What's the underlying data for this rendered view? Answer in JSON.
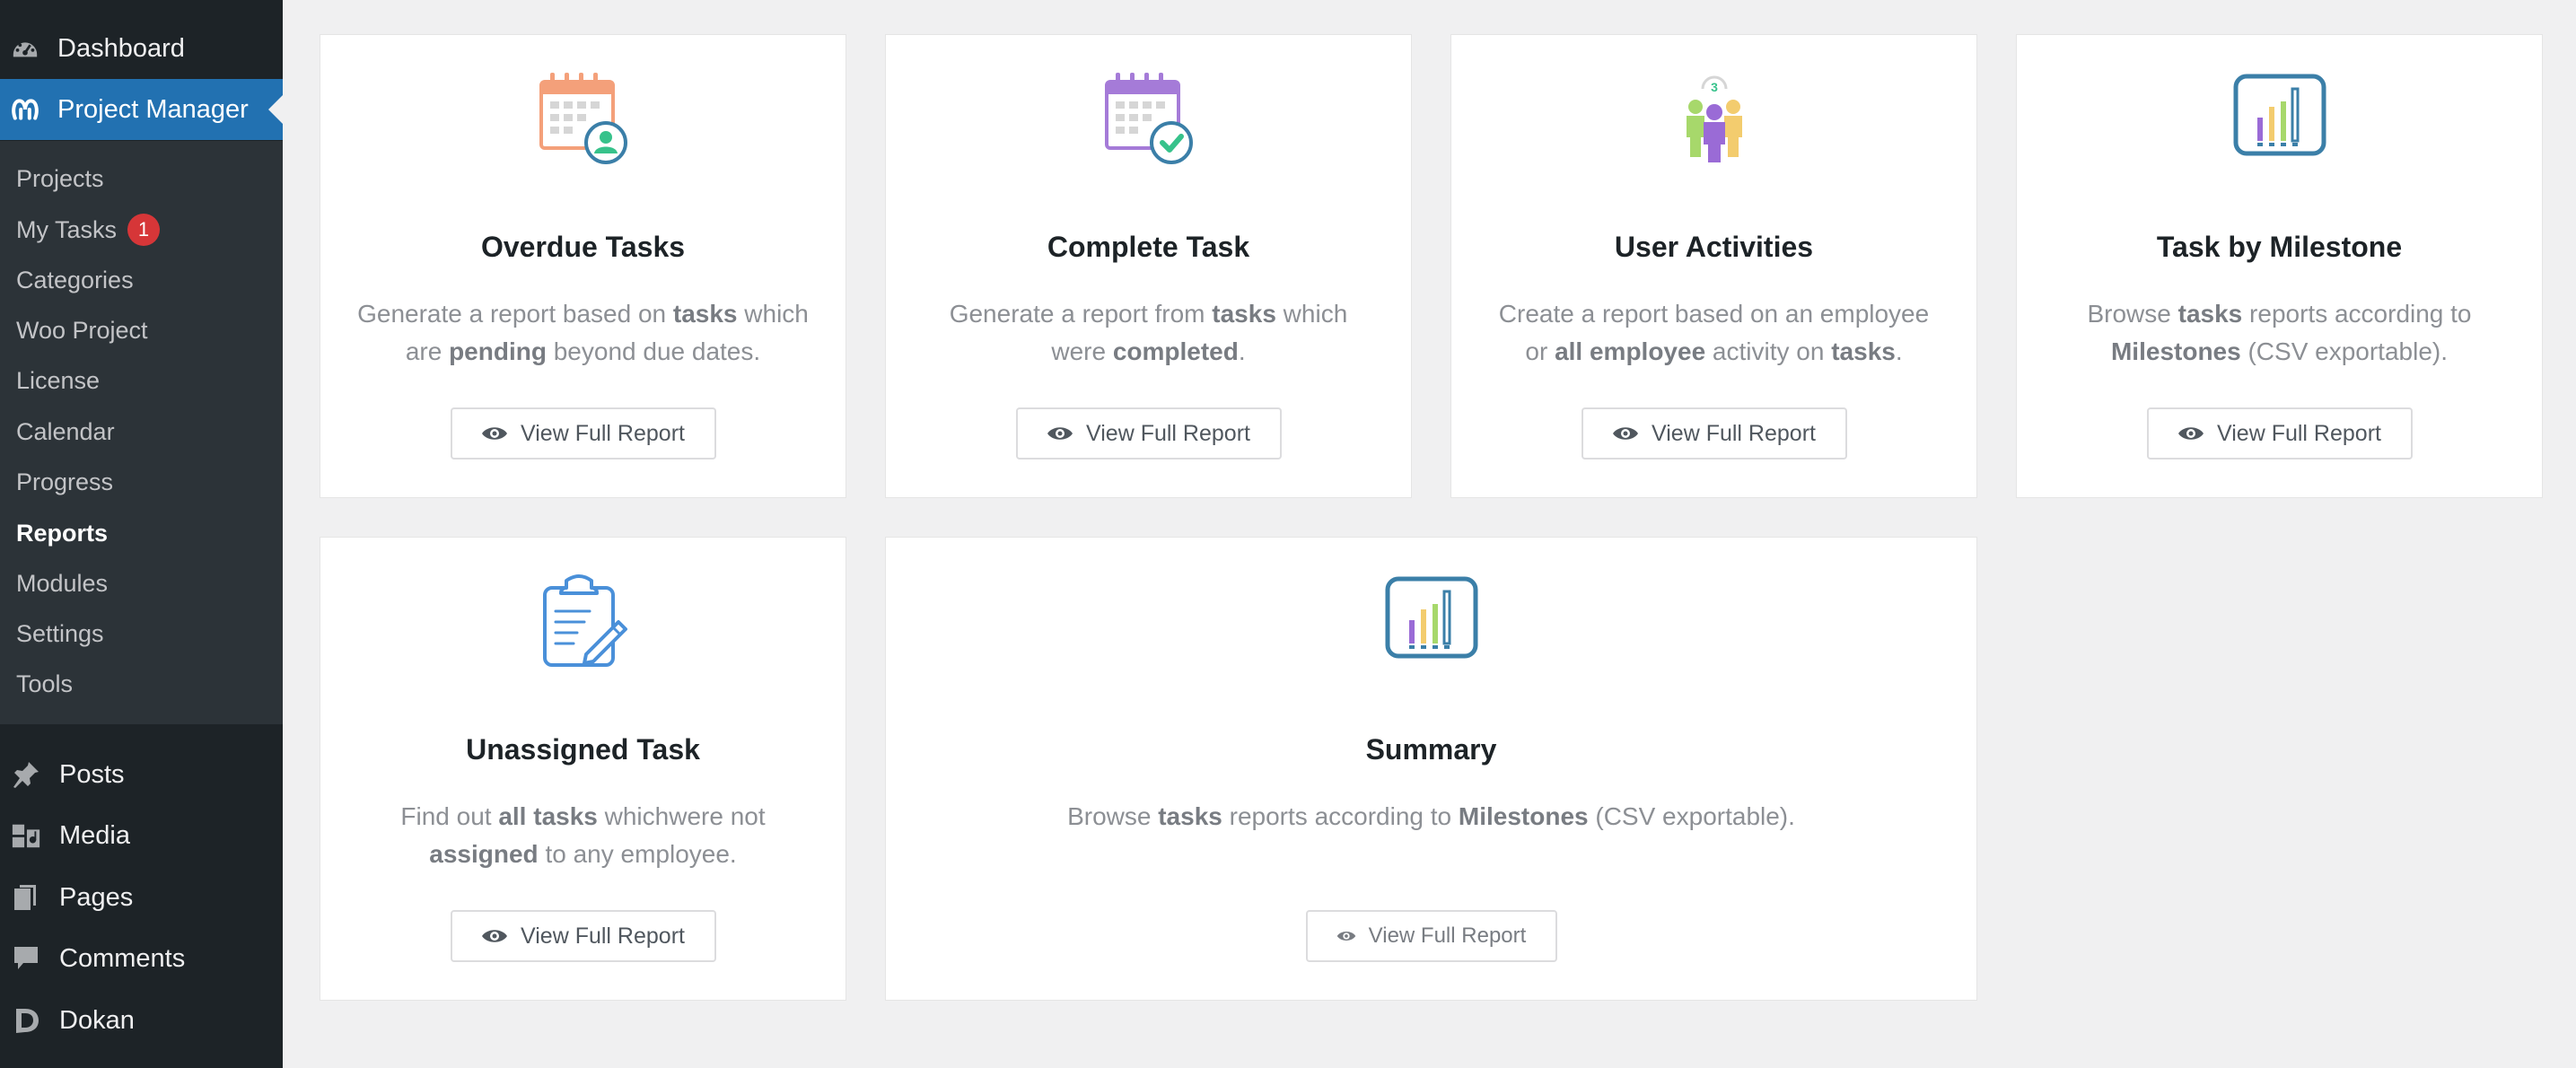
{
  "sidebar": {
    "top": [
      {
        "label": "Dashboard",
        "icon": "dashboard-icon"
      },
      {
        "label": "Project Manager",
        "icon": "project-manager-logo-icon"
      }
    ],
    "submenu": [
      {
        "label": "Projects"
      },
      {
        "label": "My Tasks",
        "badge": "1"
      },
      {
        "label": "Categories"
      },
      {
        "label": "Woo Project"
      },
      {
        "label": "License"
      },
      {
        "label": "Calendar"
      },
      {
        "label": "Progress"
      },
      {
        "label": "Reports",
        "current": true
      },
      {
        "label": "Modules"
      },
      {
        "label": "Settings"
      },
      {
        "label": "Tools"
      }
    ],
    "bottom": [
      {
        "label": "Posts",
        "icon": "pin-icon"
      },
      {
        "label": "Media",
        "icon": "media-icon"
      },
      {
        "label": "Pages",
        "icon": "pages-icon"
      },
      {
        "label": "Comments",
        "icon": "comment-bubble-icon"
      },
      {
        "label": "Dokan",
        "icon": "dokan-logo-icon"
      }
    ]
  },
  "reports": [
    {
      "title": "Overdue Tasks",
      "desc": [
        [
          "Generate a report based on ",
          false
        ],
        [
          "tasks",
          true
        ],
        [
          " which are ",
          false
        ],
        [
          "pending",
          true
        ],
        [
          " beyond due dates.",
          false
        ]
      ],
      "button": "View Full Report",
      "icon": "calendar-user-icon"
    },
    {
      "title": "Complete Task",
      "desc": [
        [
          "Generate a report from ",
          false
        ],
        [
          "tasks",
          true
        ],
        [
          " which were ",
          false
        ],
        [
          "completed",
          true
        ],
        [
          ".",
          false
        ]
      ],
      "button": "View Full Report",
      "icon": "calendar-check-icon"
    },
    {
      "title": "User Activities",
      "desc": [
        [
          "Create a report based on an employee or ",
          false
        ],
        [
          "all employee",
          true
        ],
        [
          " activity on ",
          false
        ],
        [
          "tasks",
          true
        ],
        [
          ".",
          false
        ]
      ],
      "button": "View Full Report",
      "icon": "user-group-icon",
      "icon_badge": "3"
    },
    {
      "title": "Task by Milestone",
      "desc": [
        [
          "Browse ",
          false
        ],
        [
          "tasks",
          true
        ],
        [
          " reports according to ",
          false
        ],
        [
          "Milestones",
          true
        ],
        [
          " (CSV exportable).",
          false
        ]
      ],
      "button": "View Full Report",
      "icon": "bar-chart-icon"
    },
    {
      "title": "Unassigned Task",
      "desc": [
        [
          "Find out ",
          false
        ],
        [
          "all tasks",
          true
        ],
        [
          " whichwere not ",
          false
        ],
        [
          "assigned",
          true
        ],
        [
          " to any employee.",
          false
        ]
      ],
      "button": "View Full Report",
      "icon": "clipboard-pencil-icon"
    },
    {
      "title": "Summary",
      "desc": [
        [
          "Browse ",
          false
        ],
        [
          "tasks",
          true
        ],
        [
          " reports according to ",
          false
        ],
        [
          "Milestones",
          true
        ],
        [
          " (CSV exportable).",
          false
        ]
      ],
      "button": "View Full Report",
      "icon": "bar-chart-icon"
    }
  ],
  "colors": {
    "sidebar_bg": "#1d2327",
    "submenu_bg": "#2c3338",
    "active_bg": "#2271b1",
    "badge_bg": "#d63638",
    "page_bg": "#f0f0f1"
  }
}
